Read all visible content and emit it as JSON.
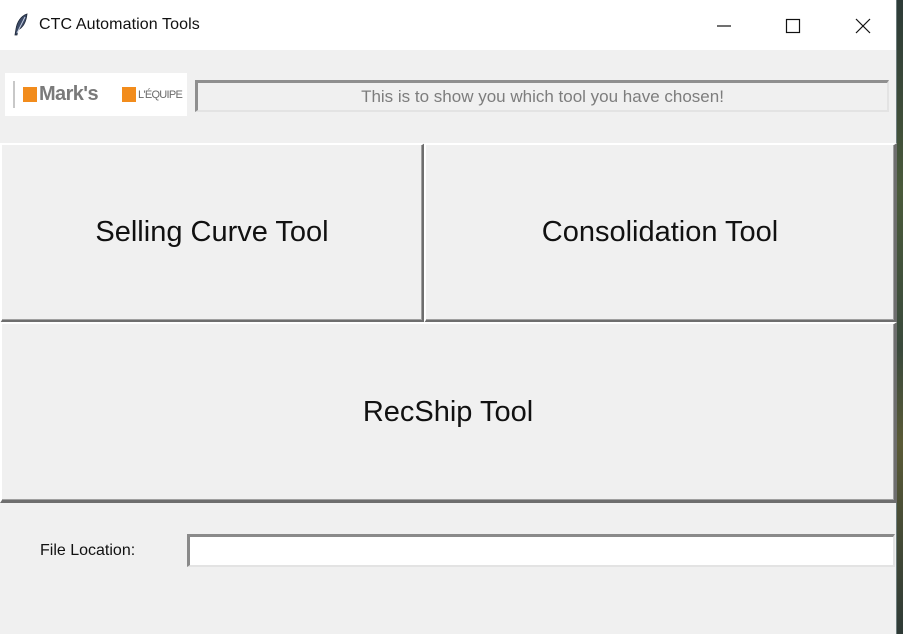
{
  "window": {
    "title": "CTC Automation Tools",
    "icon": "feather-icon"
  },
  "logo": {
    "brand_primary": "Mark's",
    "brand_secondary": "L'ÉQUIPE",
    "accent_color": "#f28c1c"
  },
  "status": {
    "message": "This is to show you which tool you have chosen!"
  },
  "tools": {
    "selling_curve_label": "Selling Curve Tool",
    "consolidation_label": "Consolidation Tool",
    "recship_label": "RecShip Tool"
  },
  "file": {
    "label": "File Location:",
    "value": ""
  }
}
